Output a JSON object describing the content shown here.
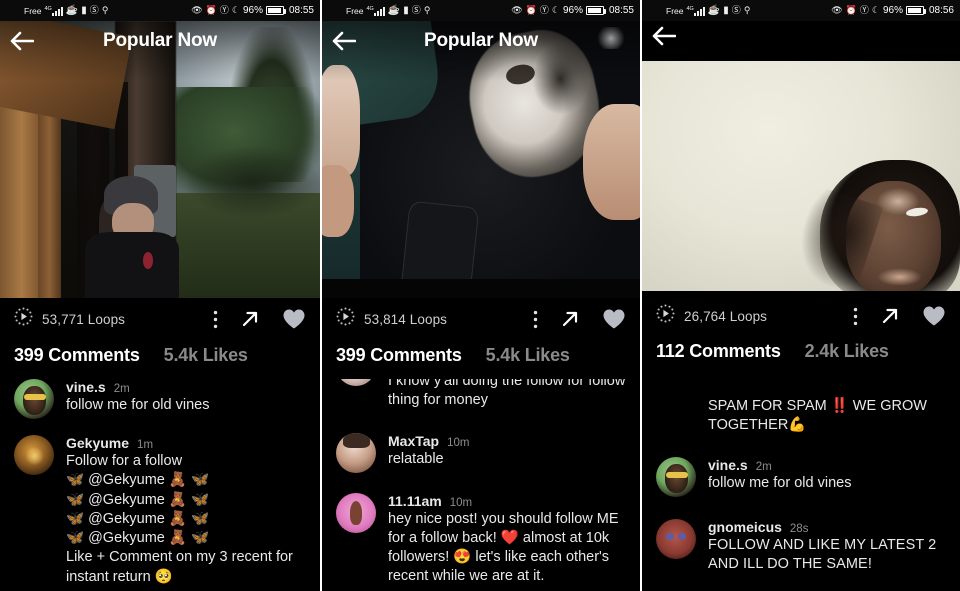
{
  "app": {
    "title": "Popular Now",
    "back_icon": "back-arrow-icon"
  },
  "status_bar": {
    "carrier": "Free",
    "network_generation": "4G",
    "battery_percent": "96%",
    "icons": [
      "signal-bars-icon",
      "dnd-icon",
      "sd-card-icon",
      "do-not-disturb-icon",
      "location-icon",
      "eye-icon",
      "alarm-icon",
      "bluetooth-icon",
      "moon-icon",
      "battery-icon"
    ],
    "time_panel1": "08:55",
    "time_panel2": "08:55",
    "time_panel3": "08:56"
  },
  "icons": {
    "loop": "loop-play-icon",
    "more": "more-vertical-icon",
    "share": "share-arrow-icon",
    "like": "heart-icon"
  },
  "panels": [
    {
      "id": "panel-1",
      "show_title": true,
      "loops": "53,771 Loops",
      "comments_count": "399 Comments",
      "likes_count": "5.4k Likes",
      "comments": [
        {
          "avatar": "av-a",
          "user": "vine.s",
          "time": "2m",
          "text": "follow me for old vines",
          "clipped": false,
          "show_head": true
        },
        {
          "avatar": "av-b",
          "user": "Gekyume",
          "time": "1m",
          "text": "Follow for a follow\n🦋 @Gekyume 🧸 🦋\n🦋 @Gekyume 🧸 🦋\n🦋 @Gekyume 🧸 🦋\n🦋 @Gekyume 🧸 🦋\nLike + Comment on my 3 recent for instant return 🥺",
          "clipped": false,
          "show_head": true
        }
      ]
    },
    {
      "id": "panel-2",
      "show_title": true,
      "loops": "53,814 Loops",
      "comments_count": "399 Comments",
      "likes_count": "5.4k Likes",
      "comments": [
        {
          "avatar": "av-c",
          "user": "",
          "time": "",
          "text": "I know y'all doing the follow for follow thing for money",
          "clipped": true,
          "show_head": false
        },
        {
          "avatar": "av-d",
          "user": "MaxTap",
          "time": "10m",
          "text": "relatable",
          "clipped": false,
          "show_head": true
        },
        {
          "avatar": "av-e",
          "user": "11.11am",
          "time": "10m",
          "text": "hey nice post! you should follow ME for a follow back! ❤️ almost at 10k followers! 😍 let's like each other's recent while we are at it.",
          "clipped": false,
          "show_head": true
        }
      ]
    },
    {
      "id": "panel-3",
      "show_title": false,
      "loops": "26,764 Loops",
      "comments_count": "112 Comments",
      "likes_count": "2.4k Likes",
      "comments": [
        {
          "avatar": "",
          "user": "",
          "time": "",
          "text": "🤝 @eeu 🤝\n\nSPAM FOR SPAM ‼️ WE GROW TOGETHER💪",
          "clipped": true,
          "show_head": false
        },
        {
          "avatar": "av-a",
          "user": "vine.s",
          "time": "2m",
          "text": "follow me for old vines",
          "clipped": false,
          "show_head": true
        },
        {
          "avatar": "av-f",
          "user": "gnomeicus",
          "time": "28s",
          "text": "FOLLOW AND LIKE MY LATEST 2 AND ILL DO THE SAME!",
          "clipped": false,
          "show_head": true
        }
      ]
    }
  ],
  "colors": {
    "background": "#000000",
    "primary_text": "#ffffff",
    "secondary_text": "#8a8a8a",
    "loop_text": "#cfcfcf"
  }
}
